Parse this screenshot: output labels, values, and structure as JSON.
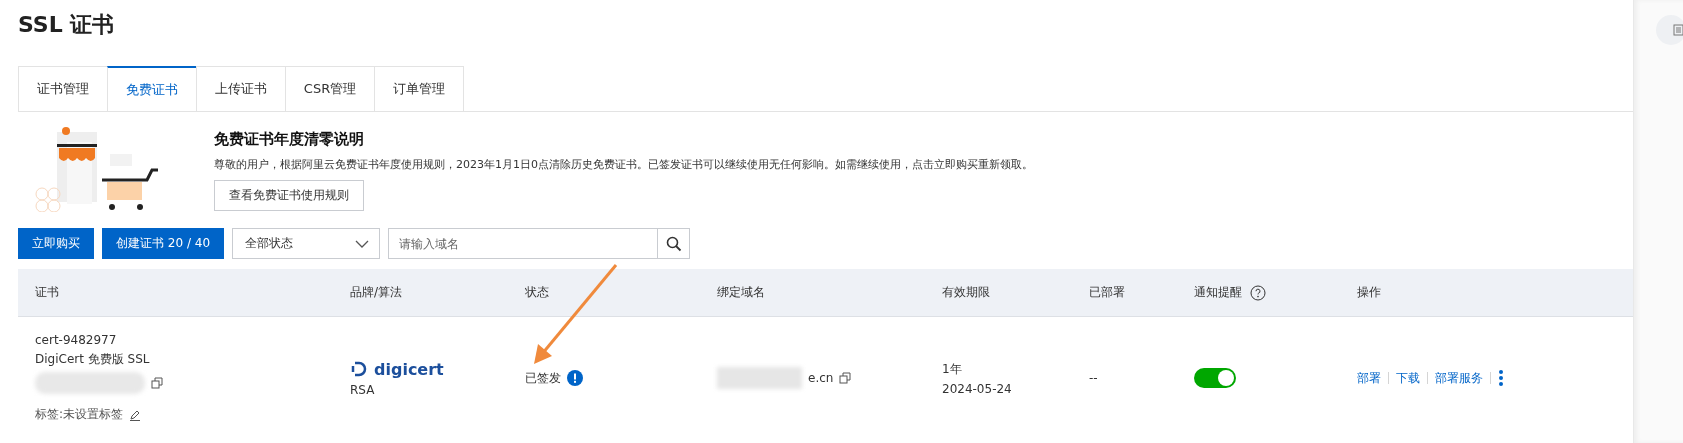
{
  "page_title": "SSL 证书",
  "tabs": [
    {
      "label": "证书管理",
      "selected": false
    },
    {
      "label": "免费证书",
      "selected": true
    },
    {
      "label": "上传证书",
      "selected": false
    },
    {
      "label": "CSR管理",
      "selected": false
    },
    {
      "label": "订单管理",
      "selected": false
    }
  ],
  "notice": {
    "title": "免费证书年度清零说明",
    "text": "尊敬的用户，根据阿里云免费证书年度使用规则，2023年1月1日0点清除历史免费证书。已签发证书可以继续使用无任何影响。如需继续使用，点击立即购买重新领取。",
    "button": "查看免费证书使用规则"
  },
  "toolbar": {
    "buy_button": "立即购买",
    "create_button": "创建证书 20 / 40",
    "status_select": "全部状态",
    "search": {
      "placeholder": "请输入域名"
    }
  },
  "table": {
    "columns": [
      "证书",
      "品牌/算法",
      "状态",
      "绑定域名",
      "有效期限",
      "已部署",
      "通知提醒",
      "操作"
    ],
    "rows": [
      {
        "cert_id": "cert-9482977",
        "cert_name": "DigiCert 免费版 SSL",
        "tag": "标签:未设置标签",
        "brand": "digicert",
        "algorithm": "RSA",
        "status": "已签发",
        "domain": "e.cn",
        "validity": "1年",
        "expiry": "2024-05-24",
        "deployed": "--",
        "notify": {
          "on": true
        },
        "actions": [
          "部署",
          "下载",
          "部署服务"
        ]
      }
    ]
  }
}
